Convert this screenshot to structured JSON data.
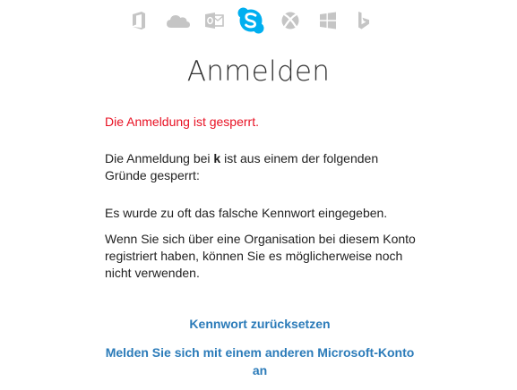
{
  "products": [
    {
      "icon": "office-icon",
      "color": "#c5c5c5"
    },
    {
      "icon": "onedrive-icon",
      "color": "#c5c5c5"
    },
    {
      "icon": "outlook-icon",
      "color": "#c5c5c5"
    },
    {
      "icon": "skype-icon",
      "color": "#00aff0",
      "active": true
    },
    {
      "icon": "xbox-icon",
      "color": "#c5c5c5"
    },
    {
      "icon": "windows-icon",
      "color": "#c5c5c5"
    },
    {
      "icon": "bing-icon",
      "color": "#c5c5c5"
    }
  ],
  "page": {
    "title": "Anmelden",
    "error": "Die Anmeldung ist gesperrt.",
    "reason_prefix": "Die Anmeldung bei ",
    "account": "k",
    "reason_suffix": " ist aus einem der folgenden Gründe gesperrt:",
    "reason_1": "Es wurde zu oft das falsche Kennwort eingegeben.",
    "reason_2": "Wenn Sie sich über eine Organisation bei diesem Konto registriert haben, können Sie es möglicherweise noch nicht verwenden."
  },
  "links": {
    "reset_password": "Kennwort zurücksetzen",
    "other_account": "Melden Sie sich mit einem anderen Microsoft-Konto an"
  },
  "colors": {
    "error": "#e81123",
    "link": "#2b7bb9",
    "inactive_icon": "#c5c5c5",
    "skype": "#00aff0"
  }
}
